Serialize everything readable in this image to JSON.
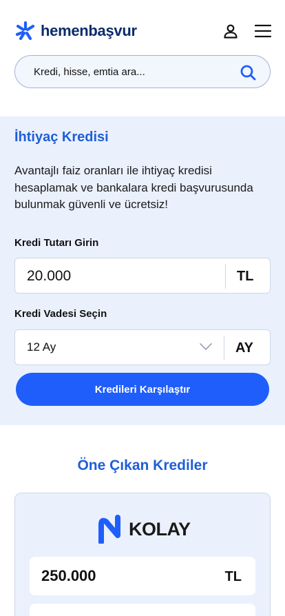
{
  "header": {
    "brand": "hemenbaşvur"
  },
  "search": {
    "placeholder": "Kredi, hisse, emtia ara..."
  },
  "loan_form": {
    "title": "İhtiyaç Kredisi",
    "description": "Avantajlı faiz oranları ile ihtiyaç kredisi hesaplamak ve bankalara kredi başvurusunda bulunmak güvenli ve ücretsiz!",
    "amount_label": "Kredi Tutarı Girin",
    "amount_value": "20.000",
    "amount_unit": "TL",
    "term_label": "Kredi Vadesi Seçin",
    "term_value": "12 Ay",
    "term_unit": "AY",
    "compare_button": "Kredileri Karşılaştır"
  },
  "featured": {
    "title": "Öne Çıkan Krediler",
    "cards": [
      {
        "bank_name": "KOLAY",
        "amount": "250.000",
        "amount_unit": "TL"
      }
    ]
  },
  "colors": {
    "brand_blue": "#1f5ed6",
    "button_blue": "#1f5efa",
    "section_bg": "#eaf1fd",
    "logo_dark": "#0b2b6b"
  },
  "icons": {
    "logo": "asterisk-logo-icon",
    "user": "user-icon",
    "menu": "hamburger-menu-icon",
    "search": "search-icon",
    "chevron": "chevron-down-icon"
  }
}
